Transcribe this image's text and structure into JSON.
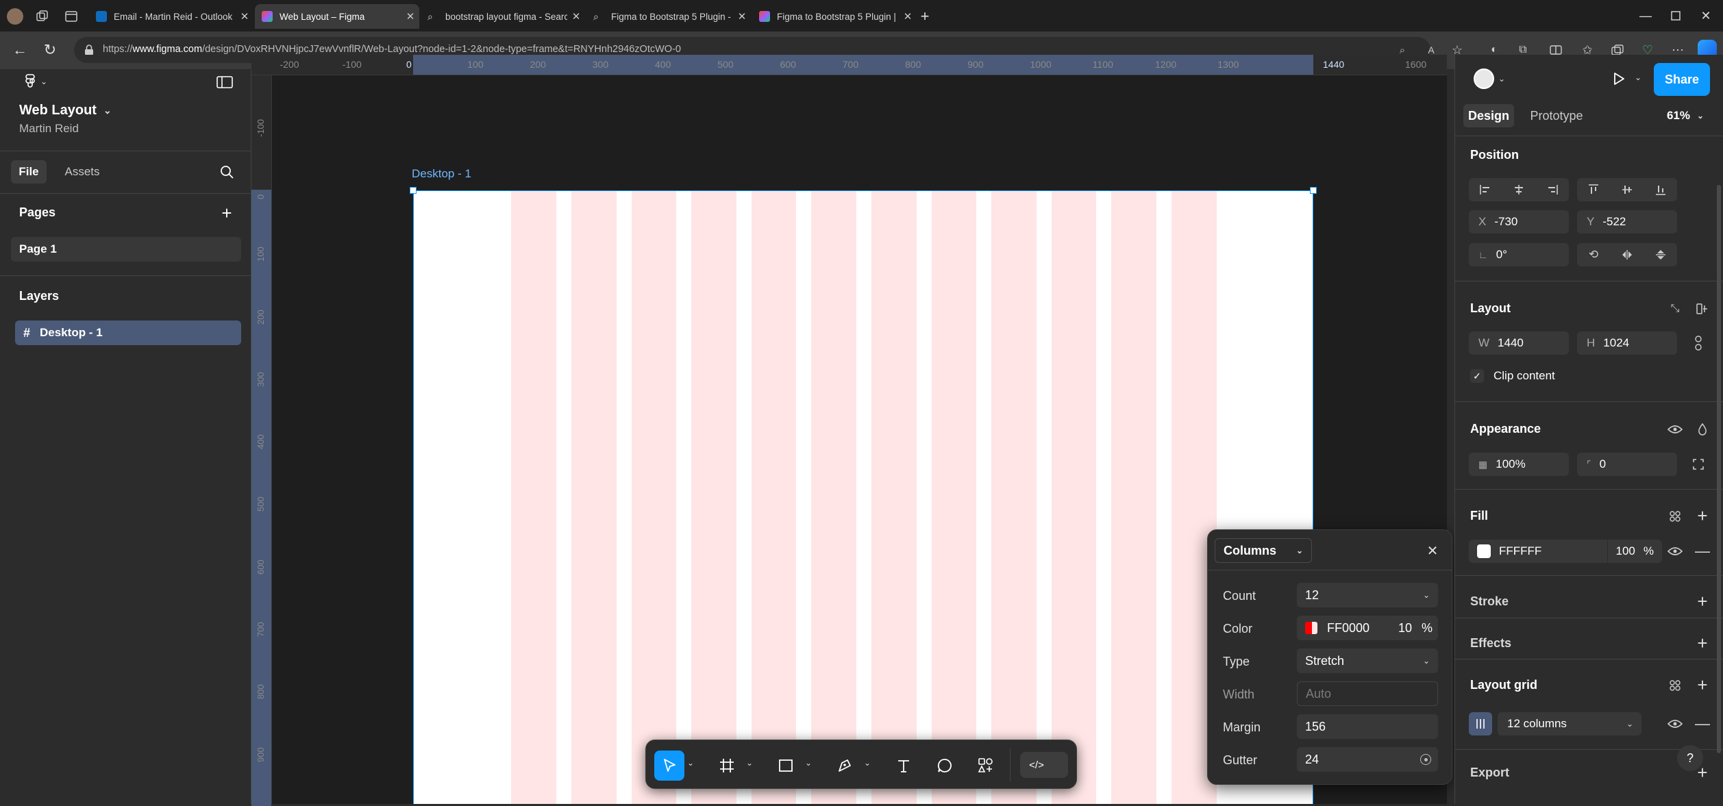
{
  "browser": {
    "tabs": [
      {
        "title": "Email - Martin Reid - Outlook",
        "active": false
      },
      {
        "title": "Web Layout – Figma",
        "active": true
      },
      {
        "title": "bootstrap layout figma - Search",
        "active": false
      },
      {
        "title": "Figma to Bootstrap 5 Plugin - Sea",
        "active": false
      },
      {
        "title": "Figma to Bootstrap 5 Plugin | Fig",
        "active": false
      }
    ],
    "url_prefix": "https://",
    "url_domain": "www.figma.com",
    "url_path": "/design/DVoxRHVNHjpcJ7ewVvnflR/Web-Layout?node-id=1-2&node-type=frame&t=RNYHnh2946zOtcWO-0"
  },
  "file": {
    "name": "Web Layout",
    "owner": "Martin Reid",
    "tabs": [
      "File",
      "Assets"
    ],
    "pages_heading": "Pages",
    "pages": [
      "Page 1"
    ],
    "layers_heading": "Layers",
    "layers": [
      "Desktop - 1"
    ]
  },
  "rulers": {
    "top": [
      "-200",
      "-100",
      "0",
      "100",
      "200",
      "300",
      "400",
      "500",
      "600",
      "700",
      "800",
      "900",
      "1000",
      "1100",
      "1200",
      "1300",
      "1440",
      "1600"
    ],
    "left": [
      "-100",
      "0",
      "100",
      "200",
      "300",
      "400",
      "500",
      "600",
      "700",
      "800",
      "900"
    ]
  },
  "canvas": {
    "frame_label": "Desktop - 1",
    "frame_bg": "#FFFFFF",
    "column_color": "#FF0000",
    "selection_color": "#0d99ff"
  },
  "design_panel": {
    "tabs": [
      "Design",
      "Prototype"
    ],
    "zoom": "61%",
    "share_label": "Share",
    "position": {
      "heading": "Position",
      "x_label": "X",
      "x": "-730",
      "y_label": "Y",
      "y": "-522",
      "rotation": "0°"
    },
    "layout": {
      "heading": "Layout",
      "w_label": "W",
      "w": "1440",
      "h_label": "H",
      "h": "1024",
      "clip_label": "Clip content"
    },
    "appearance": {
      "heading": "Appearance",
      "opacity": "100%",
      "radius": "0"
    },
    "fill": {
      "heading": "Fill",
      "hex": "FFFFFF",
      "opacity": "100",
      "unit": "%"
    },
    "stroke": {
      "heading": "Stroke"
    },
    "effects": {
      "heading": "Effects"
    },
    "layout_grid": {
      "heading": "Layout grid",
      "value": "12 columns"
    },
    "export": {
      "heading": "Export"
    },
    "help": "?"
  },
  "grid_popup": {
    "type_select": "Columns",
    "rows": {
      "count_label": "Count",
      "count": "12",
      "color_label": "Color",
      "color_hex": "FF0000",
      "color_opacity": "10",
      "color_unit": "%",
      "type_label": "Type",
      "type": "Stretch",
      "width_label": "Width",
      "width_placeholder": "Auto",
      "margin_label": "Margin",
      "margin": "156",
      "gutter_label": "Gutter",
      "gutter": "24"
    }
  },
  "toolbar": {
    "tools": [
      "move-tool",
      "frame-tool",
      "rectangle-tool",
      "pen-tool",
      "text-tool",
      "comment-tool",
      "actions-tool",
      "dev-mode-toggle"
    ]
  },
  "colors": {
    "accent": "#0d99ff",
    "panel": "#2c2c2c",
    "canvas": "#1e1e1e"
  }
}
